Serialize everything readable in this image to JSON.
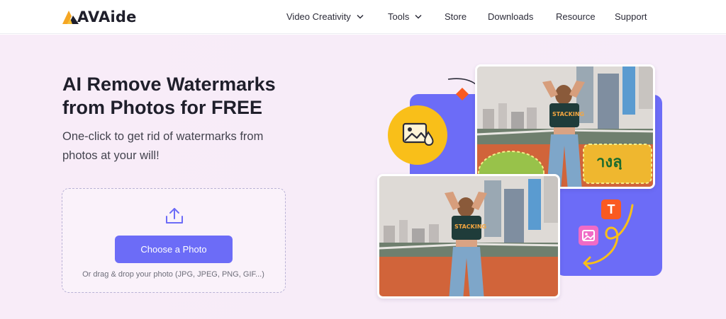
{
  "header": {
    "brand": "AVAide",
    "nav": [
      {
        "label": "Video Creativity",
        "dropdown": true
      },
      {
        "label": "Tools",
        "dropdown": true
      },
      {
        "label": "Store",
        "dropdown": false
      },
      {
        "label": "Downloads",
        "dropdown": false
      },
      {
        "label": "Resource",
        "dropdown": false
      },
      {
        "label": "Support",
        "dropdown": false
      }
    ]
  },
  "hero": {
    "title": "AI Remove Watermarks from Photos for FREE",
    "subtitle": "One-click to get rid of watermarks from photos at your will!",
    "upload": {
      "icon": "upload-icon",
      "button_label": "Choose a Photo",
      "hint": "Or drag & drop your photo (JPG, JPEG, PNG, GIF...)"
    }
  },
  "illustration": {
    "text_tool_glyph": "T",
    "icons": [
      "image-watermark-icon",
      "text-tool-icon",
      "image-tool-icon"
    ],
    "colors": {
      "accent": "#6c6cf7",
      "badge": "#f9bf19",
      "text_tool": "#fa5a21",
      "image_tool": "#f06bc6",
      "diamond": "#fa5a21"
    }
  }
}
